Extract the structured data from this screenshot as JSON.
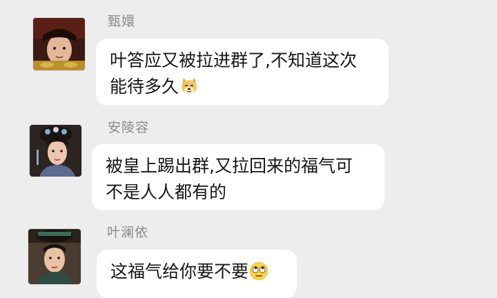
{
  "messages": [
    {
      "sender": "甄嬛",
      "text": "叶答应又被拉进群了,不知道这次\n能待多久",
      "emoji": "doge-face-icon",
      "avatar": "avatar-zhen-huan"
    },
    {
      "sender": "安陵容",
      "text": "被皇上踢出群,又拉回来的福气可\n不是人人都有的",
      "emoji": "",
      "avatar": "avatar-an-lingrong"
    },
    {
      "sender": "叶澜依",
      "text": "这福气给你要不要",
      "emoji": "eye-roll-emoji-icon",
      "avatar": "avatar-ye-lanyi"
    }
  ]
}
